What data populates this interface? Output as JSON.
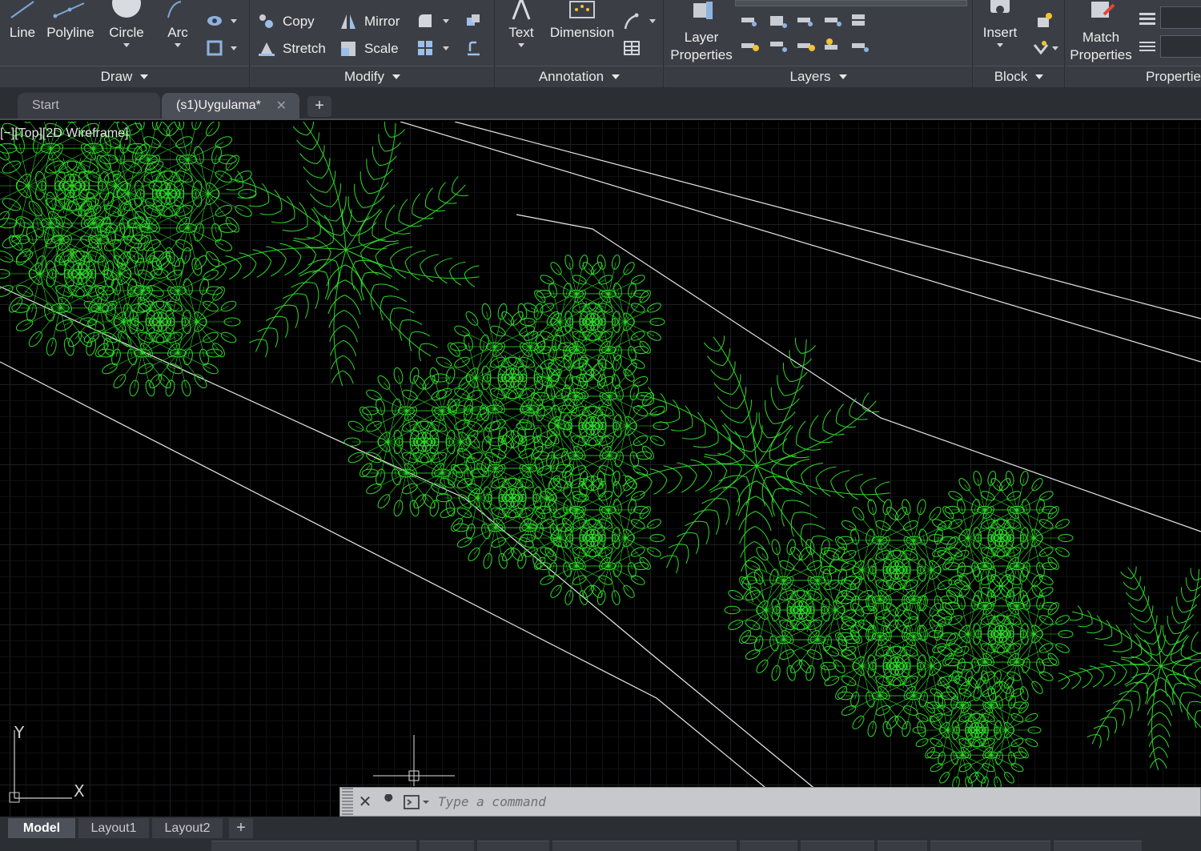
{
  "ribbon": {
    "panels": {
      "draw": {
        "title": "Draw",
        "tools": {
          "line": "Line",
          "polyline": "Polyline",
          "circle": "Circle",
          "arc": "Arc"
        }
      },
      "modify": {
        "title": "Modify",
        "tools": {
          "copy": "Copy",
          "mirror": "Mirror",
          "stretch": "Stretch",
          "scale": "Scale"
        }
      },
      "annotation": {
        "title": "Annotation",
        "tools": {
          "text": "Text",
          "dimension": "Dimension"
        }
      },
      "layers": {
        "title": "Layers",
        "tools": {
          "layer_properties_line1": "Layer",
          "layer_properties_line2": "Properties"
        }
      },
      "block": {
        "title": "Block",
        "tools": {
          "insert": "Insert"
        }
      },
      "properties": {
        "title": "Propertie",
        "tools": {
          "match_line1": "Match",
          "match_line2": "Properties"
        }
      }
    }
  },
  "file_tabs": {
    "start": "Start",
    "active": "(s1)Uygulama*",
    "add": "+"
  },
  "viewport": {
    "label": "[−][Top][2D Wireframe]",
    "ucs": {
      "y": "Y",
      "x": "X"
    },
    "colors": {
      "background": "#000000",
      "plants": "#2fd92a",
      "lines": "#e8e8e8",
      "grid": "#1c1f22"
    }
  },
  "command_line": {
    "placeholder": "Type a command"
  },
  "layout_tabs": {
    "model": "Model",
    "layout1": "Layout1",
    "layout2": "Layout2",
    "add": "+"
  }
}
